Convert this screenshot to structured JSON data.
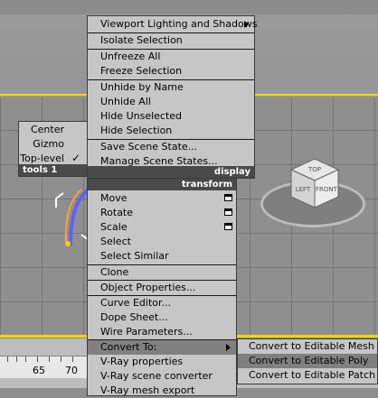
{
  "left_menu": {
    "items": [
      "Center",
      "Gizmo",
      "Top-level"
    ],
    "checked": "Top-level",
    "footer_left": "tools 1"
  },
  "display_menu": {
    "items": [
      "Viewport Lighting and Shadows",
      "Isolate Selection",
      "Unfreeze All",
      "Freeze Selection",
      "Unhide by Name",
      "Unhide All",
      "Hide Unselected",
      "Hide Selection",
      "Save Scene State...",
      "Manage Scene States..."
    ],
    "header": "display"
  },
  "transform_menu": {
    "header": "transform",
    "items": [
      "Move",
      "Rotate",
      "Scale",
      "Select",
      "Select Similar",
      "Clone",
      "Object Properties...",
      "Curve Editor...",
      "Dope Sheet...",
      "Wire Parameters...",
      "Convert To:",
      "V-Ray properties",
      "V-Ray scene converter",
      "V-Ray mesh export"
    ]
  },
  "convert_submenu": {
    "items": [
      "Convert to Editable Mesh",
      "Convert to Editable Poly",
      "Convert to Editable Patch"
    ],
    "highlighted": "Convert to Editable Poly"
  },
  "viewcube": {
    "top": "TOP",
    "left": "LEFT",
    "front": "FRONT"
  },
  "timeline": {
    "labels": [
      "65",
      "70"
    ]
  },
  "colors": {
    "menu_bg": "#c6c6c6",
    "highlight": "#808080",
    "header_bg": "#4a4a4a",
    "viewport_border": "#f0d800"
  }
}
